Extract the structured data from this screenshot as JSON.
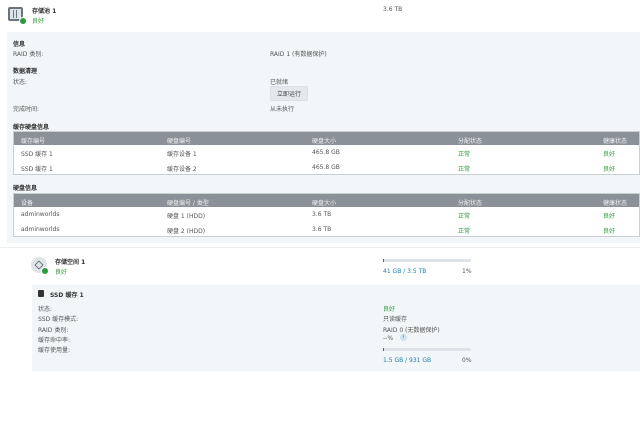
{
  "pool": {
    "title": "存储池 1",
    "status": "良好",
    "size": "3.6 TB"
  },
  "info": {
    "heading": "信息",
    "raid_label": "RAID 类别:",
    "raid_value": "RAID 1 (有数据保护)"
  },
  "scrub": {
    "heading": "数据清理",
    "status_label": "状态:",
    "status_value": "已就绪",
    "run_button": "立即运行",
    "finish_label": "完成时间:",
    "finish_value": "从未执行"
  },
  "cache_table": {
    "heading": "缓存硬盘信息",
    "columns": [
      "缓存编号",
      "硬盘编号",
      "硬盘大小",
      "分配状态",
      "健康状态"
    ],
    "rows": [
      [
        "SSD 缓存 1",
        "缓存设备 1",
        "465.8 GB",
        "正常",
        "良好"
      ],
      [
        "SSD 缓存 1",
        "缓存设备 2",
        "465.8 GB",
        "正常",
        "良好"
      ]
    ]
  },
  "disk_table": {
    "heading": "硬盘信息",
    "columns": [
      "设备",
      "硬盘编号 / 类型",
      "硬盘大小",
      "分配状态",
      "健康状态"
    ],
    "rows": [
      [
        "adminworlds",
        "硬盘 1 (HDD)",
        "3.6 TB",
        "正常",
        "良好"
      ],
      [
        "adminworlds",
        "硬盘 2 (HDD)",
        "3.6 TB",
        "正常",
        "良好"
      ]
    ]
  },
  "volume": {
    "title": "存储空间 1",
    "status": "良好",
    "used": "41 GB / 3.5 TB",
    "percent_label": "1%",
    "usage_fraction": 0.01
  },
  "ssd_cache": {
    "title": "SSD 缓存 1",
    "fields": [
      {
        "label": "状态:",
        "value": "良好"
      },
      {
        "label": "SSD 缓存模式:",
        "value": "只读缓存"
      },
      {
        "label": "RAID 类别:",
        "value": "RAID 0 (无数据保护)"
      },
      {
        "label": "缓存命中率:",
        "value": "--%"
      },
      {
        "label": "缓存使用量:",
        "value": ""
      }
    ],
    "used": "1.5 GB / 931 GB",
    "percent_label": "0%",
    "usage_fraction": 0.002,
    "info_icon": "i"
  },
  "colors": {
    "green": "#2a9a3a",
    "blue": "#1f7fa8",
    "header": "#8b9198"
  }
}
